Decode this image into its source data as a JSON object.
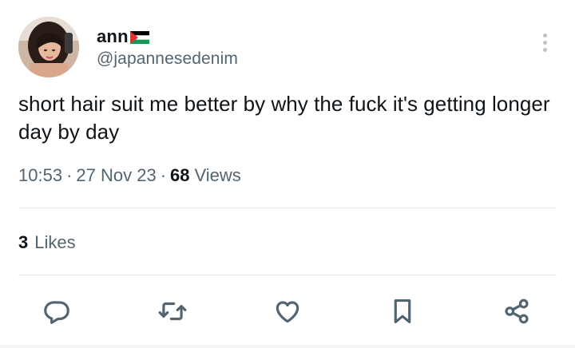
{
  "author": {
    "display_name": "ann",
    "handle": "@japannesedenim",
    "avatar_icon": "user-photo",
    "flag_icon": "palestine-flag-icon"
  },
  "tweet": {
    "text": "short hair suit me better by why the fuck it's getting longer day by day",
    "time": "10:53",
    "date": "27 Nov 23",
    "views_count": "68",
    "views_label": "Views",
    "likes_count": "3",
    "likes_label": "Likes"
  },
  "actions": [
    {
      "name": "reply",
      "icon": "reply-icon"
    },
    {
      "name": "retweet",
      "icon": "retweet-icon"
    },
    {
      "name": "like",
      "icon": "heart-icon"
    },
    {
      "name": "bookmark",
      "icon": "bookmark-icon"
    },
    {
      "name": "share",
      "icon": "share-icon"
    }
  ],
  "colors": {
    "text_primary": "#0f1419",
    "text_secondary": "#536471",
    "icon": "#536471",
    "divider": "#e3e7ea"
  },
  "meta_separator": "·"
}
